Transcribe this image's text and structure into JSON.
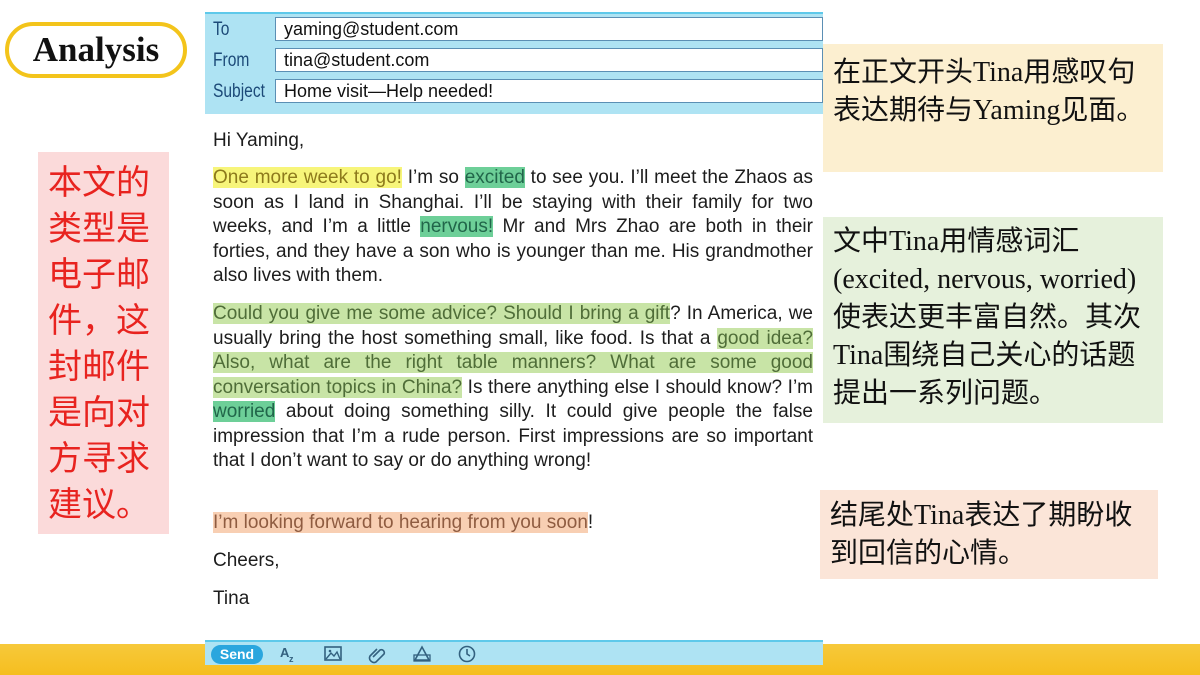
{
  "analysis_label": "Analysis",
  "type_note": "本文的类型是电子邮件，这封邮件是向对方寻求建议。",
  "notes": {
    "opening": "在正文开头Tina用感叹句表达期待与Yaming见面。",
    "emotion": "文中Tina用情感词汇(excited, nervous, worried)使表达更丰富自然。其次Tina围绕自己关心的话题提出一系列问题。",
    "ending": "结尾处Tina表达了期盼收到回信的心情。"
  },
  "email": {
    "to_label": "To",
    "to_value": "yaming@student.com",
    "from_label": "From",
    "from_value": "tina@student.com",
    "subject_label": "Subject",
    "subject_value": "Home visit—Help needed!",
    "greeting": "Hi Yaming,",
    "p1_hl_intro": "One more week to go!",
    "p1_a": " I’m so ",
    "p1_hl_excited": "excited",
    "p1_b": " to see you. I’ll meet the Zhaos as soon as I land in Shanghai. I’ll be staying with their family for two weeks, and I’m a little ",
    "p1_hl_nervous": "nervous!",
    "p1_c": " Mr and Mrs Zhao are both in their forties, and they have a son who is younger than me. His grandmother also lives with them.",
    "p2_hl_q1": "Could you give me some advice? Should I bring a gift",
    "p2_a": "? In America, we usually bring the host something small, like food. Is that a ",
    "p2_hl_q2": "good idea? Also, what are the right table manners? What are some good conversation topics in China?",
    "p2_b": " Is there anything else I should know? I’m ",
    "p2_hl_worried": "worried",
    "p2_c": " about doing something silly. It could give people the false impression that I’m a rude person. First impressions are so important that I don’t want to say or do anything wrong!",
    "closing_hl": "I’m looking forward to hearing from you soon",
    "closing_end": "!",
    "cheers": "Cheers,",
    "signature": "Tina",
    "send_label": "Send"
  },
  "icons": [
    "text-format-icon",
    "image-icon",
    "attachment-icon",
    "drive-icon",
    "clock-icon"
  ],
  "colors": {
    "accent_yellow": "#f5be1f",
    "header_blue": "#aee3f3",
    "send_blue": "#2aa6de",
    "note_red": "#e8231f"
  }
}
